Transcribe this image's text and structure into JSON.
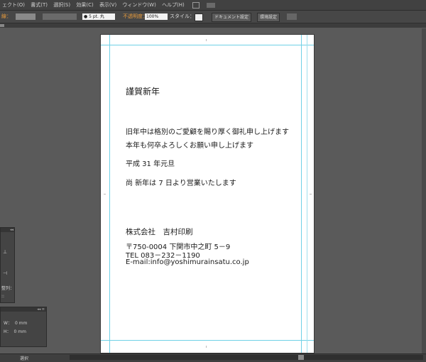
{
  "menu": {
    "items": [
      "ェクト(O)",
      "書式(T)",
      "選択(S)",
      "効果(C)",
      "表示(V)",
      "ウィンドウ(W)",
      "ヘルプ(H)"
    ]
  },
  "control_bar": {
    "stroke_label": "線：",
    "stroke_weight": "● 5 pt. 丸",
    "opacity_label": "不透明度：",
    "opacity_value": "100%",
    "style_label": "スタイル：",
    "doc_settings_button": "ドキュメント設定",
    "env_settings_button": "環境設定"
  },
  "card": {
    "greeting": "謹賀新年",
    "line1": "旧年中は格別のご愛顧を賜り厚く御礼申し上げます",
    "line2": "本年も何卒よろしくお願い申し上げます",
    "date": "平成 31 年元旦",
    "notice": "尚 新年は 7 日より営業いたします",
    "company": "株式会社　吉村印刷",
    "address": "〒750-0004  下関市中之町 5－9",
    "tel": "TEL  083－232－1190",
    "email": "E-mail:info@yoshimurainsatu.co.jp"
  },
  "align_panel": {
    "distribute_label": "整列：",
    "extra": "::"
  },
  "transform_panel": {
    "w_label": "W：",
    "w_value": "0 mm",
    "h_label": "H：",
    "h_value": "0 mm"
  },
  "status": {
    "tool": "選択"
  },
  "colors": {
    "guide": "#6fd1e6",
    "workspace": "#5a5a5a",
    "artboard": "#ffffff"
  }
}
